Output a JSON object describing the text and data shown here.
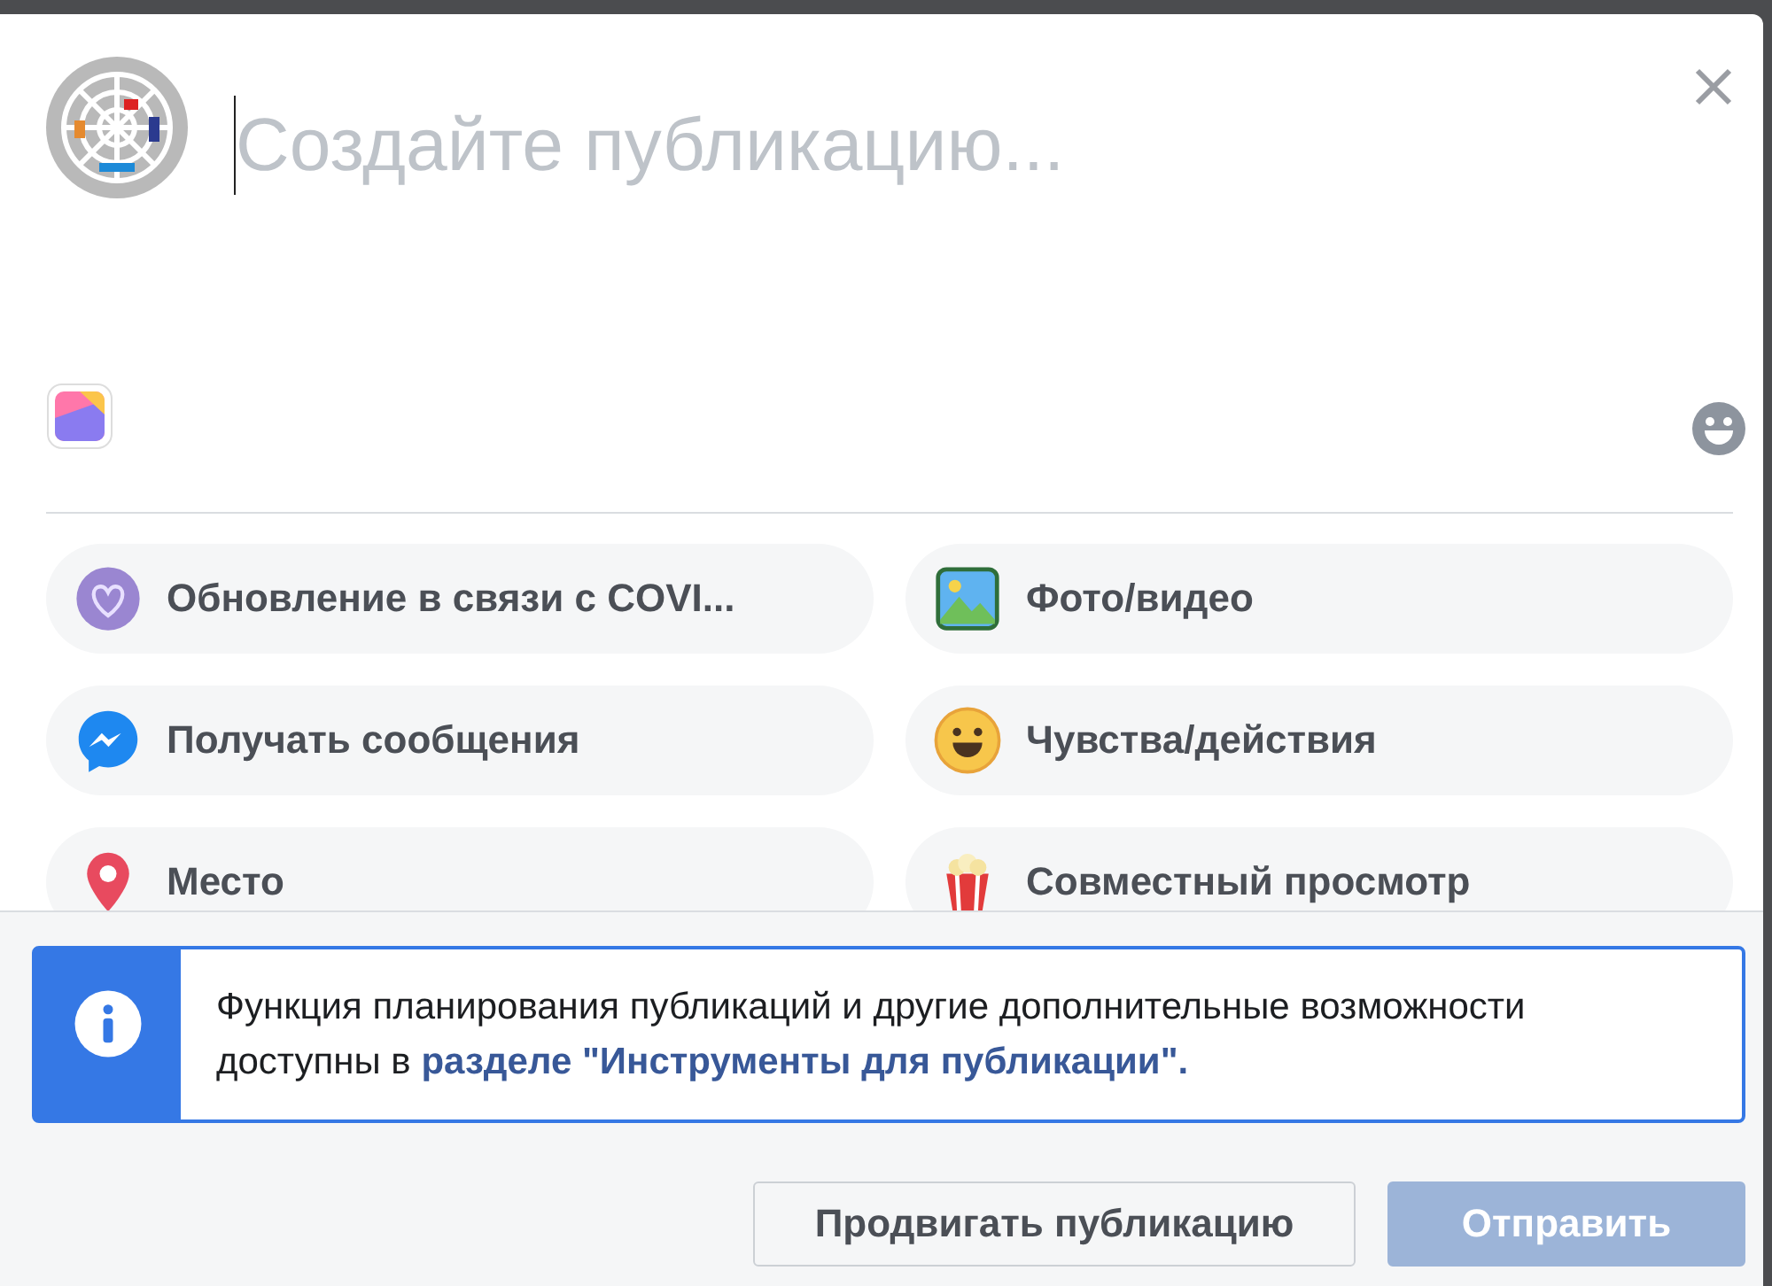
{
  "composer": {
    "placeholder": "Создайте публикацию..."
  },
  "options": [
    {
      "kind": "covid",
      "label": "Обновление в связи с COVI..."
    },
    {
      "kind": "photo",
      "label": "Фото/видео"
    },
    {
      "kind": "messenger",
      "label": "Получать сообщения"
    },
    {
      "kind": "feeling",
      "label": "Чувства/действия"
    },
    {
      "kind": "place",
      "label": "Место"
    },
    {
      "kind": "watch",
      "label": "Совместный просмотр"
    }
  ],
  "notice": {
    "text": "Функция планирования публикаций и другие дополнительные возможности доступны в ",
    "link": "разделе \"Инструменты для публикации\"."
  },
  "buttons": [
    {
      "kind": "secondary",
      "label": "Продвигать публикацию",
      "disabled": false
    },
    {
      "kind": "primary",
      "label": "Отправить",
      "disabled": true
    }
  ]
}
